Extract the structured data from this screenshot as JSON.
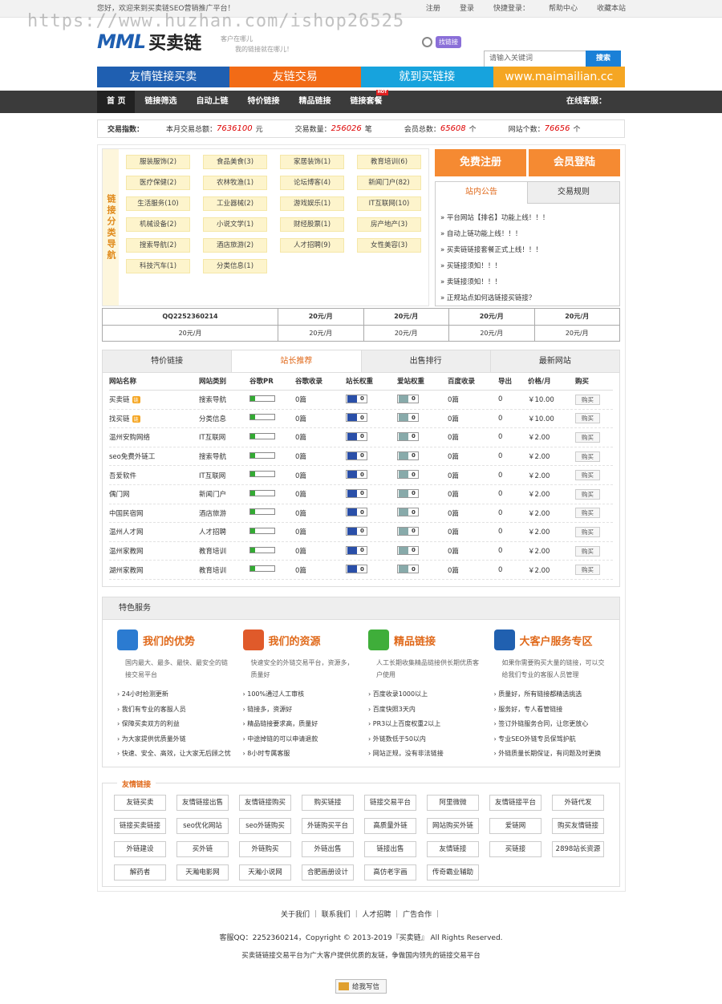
{
  "topbar": {
    "welcome": "您好，欢迎来到买卖链SEO营销推广平台！",
    "links": [
      "注册",
      "登录",
      "快捷登录：",
      "帮助中心",
      "收藏本站"
    ]
  },
  "watermark": "https://www.huzhan.com/ishop26525",
  "logo": {
    "mark": "MML",
    "name": "买卖链"
  },
  "slogan": [
    "客户在哪儿",
    "我的链接就在哪儿！"
  ],
  "find_badge": "找链接",
  "search": {
    "placeholder": "请输入关键词",
    "button": "搜索"
  },
  "banners": [
    {
      "label": "友情链接买卖",
      "color": "#1f5fb1"
    },
    {
      "label": "友链交易",
      "color": "#f26b16"
    },
    {
      "label": "就到买链接",
      "color": "#17a3dd"
    },
    {
      "label": "www.maimailian.cc",
      "color": "#f5a623"
    }
  ],
  "nav": {
    "items": [
      "首 页",
      "链接筛选",
      "自动上链",
      "特价链接",
      "精品链接",
      "链接套餐"
    ],
    "hot": "HOT",
    "kefu": "在线客服："
  },
  "stats": {
    "label": "交易指数：",
    "month_label": "本月交易总额：",
    "month_value": "7636100",
    "month_unit": "元",
    "count_label": "交易数量：",
    "count_value": "256026",
    "count_unit": "笔",
    "member_label": "会员总数：",
    "member_value": "65608",
    "member_unit": "个",
    "site_label": "网站个数：",
    "site_value": "76656",
    "site_unit": "个"
  },
  "category": {
    "label": "链接分类导航",
    "items": [
      "服装服饰(2)",
      "食品美食(3)",
      "家居装饰(1)",
      "教育培训(6)",
      "医疗保健(2)",
      "农林牧渔(1)",
      "论坛博客(4)",
      "新闻门户(82)",
      "生活服务(10)",
      "工业器械(2)",
      "游戏娱乐(1)",
      "IT互联网(10)",
      "机械设备(2)",
      "小说文学(1)",
      "财经股票(1)",
      "房产地产(3)",
      "搜索导航(2)",
      "酒店旅游(2)",
      "人才招聘(9)",
      "女性美容(3)",
      "科技汽车(1)",
      "分类信息(1)"
    ]
  },
  "buttons": {
    "register": "免费注册",
    "login": "会员登陆"
  },
  "notice": {
    "tabs": [
      "站内公告",
      "交易规则"
    ],
    "items": [
      "» 平台网站【排名】功能上线！！！",
      "» 自动上链功能上线！！！",
      "» 买卖链链接套餐正式上线！！！",
      "» 买链接须知！！！",
      "» 卖链接须知！！！",
      "» 正规站点如何选链接买链接？"
    ]
  },
  "qq_table": {
    "row1": [
      "QQ2252360214",
      "20元/月",
      "20元/月",
      "20元/月",
      "20元/月"
    ],
    "row2": [
      "20元/月",
      "20元/月",
      "20元/月",
      "20元/月",
      "20元/月"
    ]
  },
  "links_panel": {
    "tabs": [
      "特价链接",
      "站长推荐",
      "出售排行",
      "最新网站"
    ],
    "headers": [
      "网站名称",
      "网站类别",
      "谷歌PR",
      "谷歌收录",
      "站长权重",
      "爱站权重",
      "百度收录",
      "导出",
      "价格/月",
      "购买"
    ],
    "rows": [
      {
        "name": "买卖链",
        "tag": "链",
        "cat": "搜索导航",
        "gl": "0篇",
        "bw": "0",
        "aw": "0",
        "bd": "0篇",
        "ex": "0",
        "price": "￥10.00",
        "buy": "购买"
      },
      {
        "name": "找买链",
        "tag": "链",
        "cat": "分类信息",
        "gl": "0篇",
        "bw": "0",
        "aw": "0",
        "bd": "0篇",
        "ex": "0",
        "price": "￥10.00",
        "buy": "购买"
      },
      {
        "name": "温州安购网络",
        "tag": "",
        "cat": "IT互联网",
        "gl": "0篇",
        "bw": "0",
        "aw": "0",
        "bd": "0篇",
        "ex": "0",
        "price": "￥2.00",
        "buy": "购买"
      },
      {
        "name": "seo免费外链工",
        "tag": "",
        "cat": "搜索导航",
        "gl": "0篇",
        "bw": "0",
        "aw": "0",
        "bd": "0篇",
        "ex": "0",
        "price": "￥2.00",
        "buy": "购买"
      },
      {
        "name": "吾爱软件",
        "tag": "",
        "cat": "IT互联网",
        "gl": "0篇",
        "bw": "0",
        "aw": "0",
        "bd": "0篇",
        "ex": "0",
        "price": "￥2.00",
        "buy": "购买"
      },
      {
        "name": "偶门网",
        "tag": "",
        "cat": "新闻门户",
        "gl": "0篇",
        "bw": "0",
        "aw": "0",
        "bd": "0篇",
        "ex": "0",
        "price": "￥2.00",
        "buy": "购买"
      },
      {
        "name": "中国民宿网",
        "tag": "",
        "cat": "酒店旅游",
        "gl": "0篇",
        "bw": "0",
        "aw": "0",
        "bd": "0篇",
        "ex": "0",
        "price": "￥2.00",
        "buy": "购买"
      },
      {
        "name": "温州人才网",
        "tag": "",
        "cat": "人才招聘",
        "gl": "0篇",
        "bw": "0",
        "aw": "0",
        "bd": "0篇",
        "ex": "0",
        "price": "￥2.00",
        "buy": "购买"
      },
      {
        "name": "温州家教网",
        "tag": "",
        "cat": "教育培训",
        "gl": "0篇",
        "bw": "0",
        "aw": "0",
        "bd": "0篇",
        "ex": "0",
        "price": "￥2.00",
        "buy": "购买"
      },
      {
        "name": "湖州家教网",
        "tag": "",
        "cat": "教育培训",
        "gl": "0篇",
        "bw": "0",
        "aw": "0",
        "bd": "0篇",
        "ex": "0",
        "price": "￥2.00",
        "buy": "购买"
      }
    ]
  },
  "features": {
    "title": "特色服务",
    "cols": [
      {
        "title": "我们的优势",
        "icon_color": "#2b7bd1",
        "desc": "国内最大、最多、最快、最安全的链接交易平台",
        "items": [
          "› 24小时检测更新",
          "› 我们有专业的客服人员",
          "› 保障买卖双方的利益",
          "› 为大家提供优质量外链",
          "› 快速、安全、高效，让大家无后顾之忧"
        ]
      },
      {
        "title": "我们的资源",
        "icon_color": "#e05a2a",
        "desc": "快速安全的外链交易平台，资源多，质量好",
        "items": [
          "› 100%通过人工审核",
          "› 链接多，资源好",
          "› 精品链接要求高，质量好",
          "› 中途掉链的可以申请退款",
          "› 8小时专属客服"
        ]
      },
      {
        "title": "精品链接",
        "icon_color": "#3fae3a",
        "desc": "人工长期收集精品链接供长期优质客户使用",
        "items": [
          "› 百度收录1000以上",
          "› 百度快照3天内",
          "› PR3以上百度权重2以上",
          "› 外链数低于50以内",
          "› 网站正规，没有非法链接"
        ]
      },
      {
        "title": "大客户服务专区",
        "icon_color": "#2060b0",
        "desc": "如果你需要购买大量的链接，可以交给我们专业的客服人员管理",
        "items": [
          "› 质量好，所有链接都精选挑选",
          "› 服务好，专人看管链接",
          "› 签订外链服务合同，让您更放心",
          "› 专业SEO外链专员保驾护航",
          "› 外链质量长期保证，有问题及时更换"
        ]
      }
    ]
  },
  "friend_links": {
    "title": "友情链接",
    "items": [
      "友链买卖",
      "友情链接出售",
      "友情链接购买",
      "购买链接",
      "链接交易平台",
      "阿里微微",
      "友情链接平台",
      "外链代发",
      "链接买卖链接",
      "seo优化网站",
      "seo外链购买",
      "外链购买平台",
      "高质量外链",
      "网站购买外链",
      "爱链网",
      "购买友情链接",
      "外链建设",
      "买外链",
      "外链购买",
      "外链出售",
      "链接出售",
      "友情链接",
      "买链接",
      "2898站长资源",
      "解药者",
      "天瀚电影网",
      "天瀚小说网",
      "合肥画册设计",
      "高仿老字画",
      "传奇霸业辅助"
    ]
  },
  "footer": {
    "links": "关于我们 ｜ 联系我们 ｜ 人才招聘 ｜ 广告合作 ｜",
    "copyright": "客服QQ：2252360214，Copyright © 2013-2019『买卖链』 All Rights Reserved.",
    "desc": "买卖链链接交易平台为广大客户提供优质的友链，争做国内领先的链接交易平台",
    "mail": "给我写信"
  }
}
